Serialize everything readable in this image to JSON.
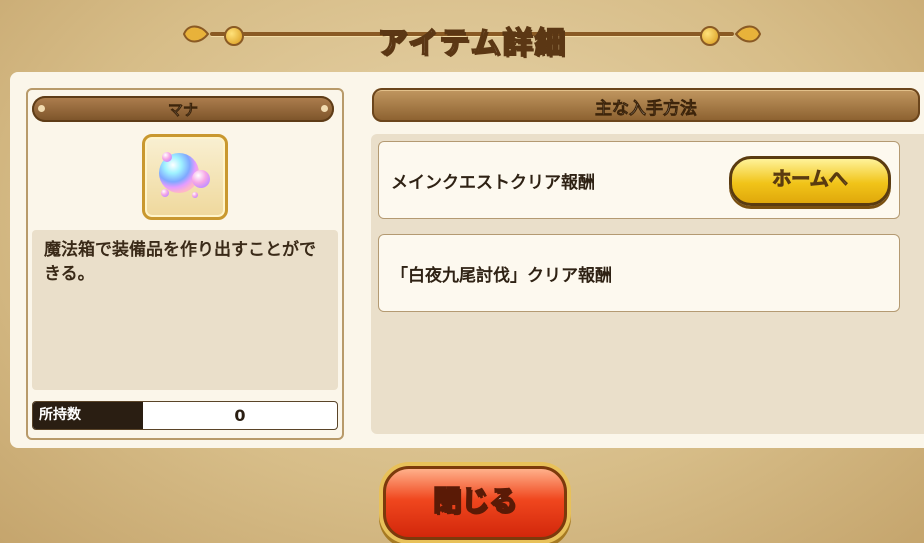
{
  "dialog": {
    "title": "アイテム詳細"
  },
  "item": {
    "name": "マナ",
    "icon": "mana-orb-icon",
    "description": "魔法箱で装備品を作り出すことができる。",
    "owned_label": "所持数",
    "owned_count": "0"
  },
  "acquisition": {
    "header": "主な入手方法",
    "methods": [
      {
        "text": "メインクエストクリア報酬",
        "button": "ホームへ"
      },
      {
        "text": "「白夜九尾討伐」クリア報酬"
      }
    ]
  },
  "footer": {
    "close_label": "閉じる"
  },
  "colors": {
    "accent_gold": "#f1c419",
    "close_red": "#f0471e",
    "header_brown": "#8a5f2e"
  }
}
